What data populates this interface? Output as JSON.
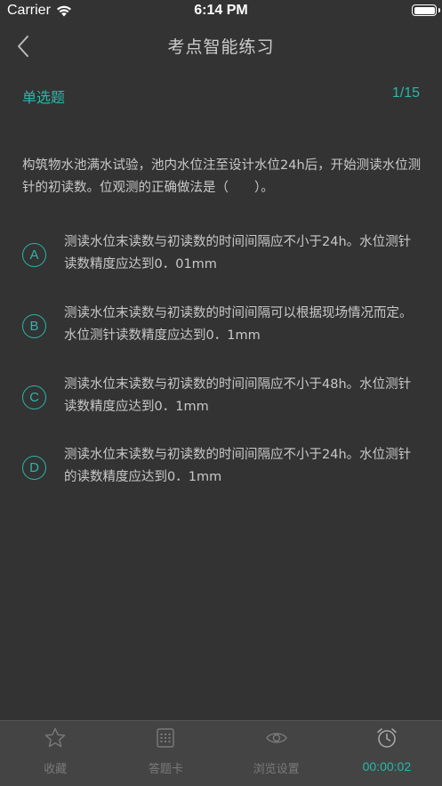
{
  "status_bar": {
    "carrier": "Carrier",
    "time": "6:14 PM"
  },
  "nav": {
    "title": "考点智能练习",
    "back_icon": "chevron-left-icon"
  },
  "question": {
    "type": "单选题",
    "counter": "1/15",
    "text": "构筑物水池满水试验，池内水位注至设计水位24h后，开始测读水位测针的初读数。位观测的正确做法是（　　）。"
  },
  "options": [
    {
      "letter": "A",
      "text": "测读水位末读数与初读数的时间间隔应不小于24h。水位测针读数精度应达到0．01mm"
    },
    {
      "letter": "B",
      "text": "测读水位末读数与初读数的时间间隔可以根据现场情况而定。水位测针读数精度应达到0．1mm"
    },
    {
      "letter": "C",
      "text": "测读水位末读数与初读数的时间间隔应不小于48h。水位测针读数精度应达到0．1mm"
    },
    {
      "letter": "D",
      "text": "测读水位末读数与初读数的时间间隔应不小于24h。水位测针的读数精度应达到0．1mm"
    }
  ],
  "tabbar": {
    "tabs": [
      {
        "label": "收藏",
        "icon": "star-icon"
      },
      {
        "label": "答题卡",
        "icon": "grid-card-icon"
      },
      {
        "label": "浏览设置",
        "icon": "eye-icon"
      },
      {
        "label": "00:00:02",
        "icon": "alarm-clock-icon"
      }
    ]
  },
  "colors": {
    "background": "#333333",
    "accent": "#2ab7a9",
    "text": "#c8c8c8",
    "tabbar": "#444444"
  }
}
